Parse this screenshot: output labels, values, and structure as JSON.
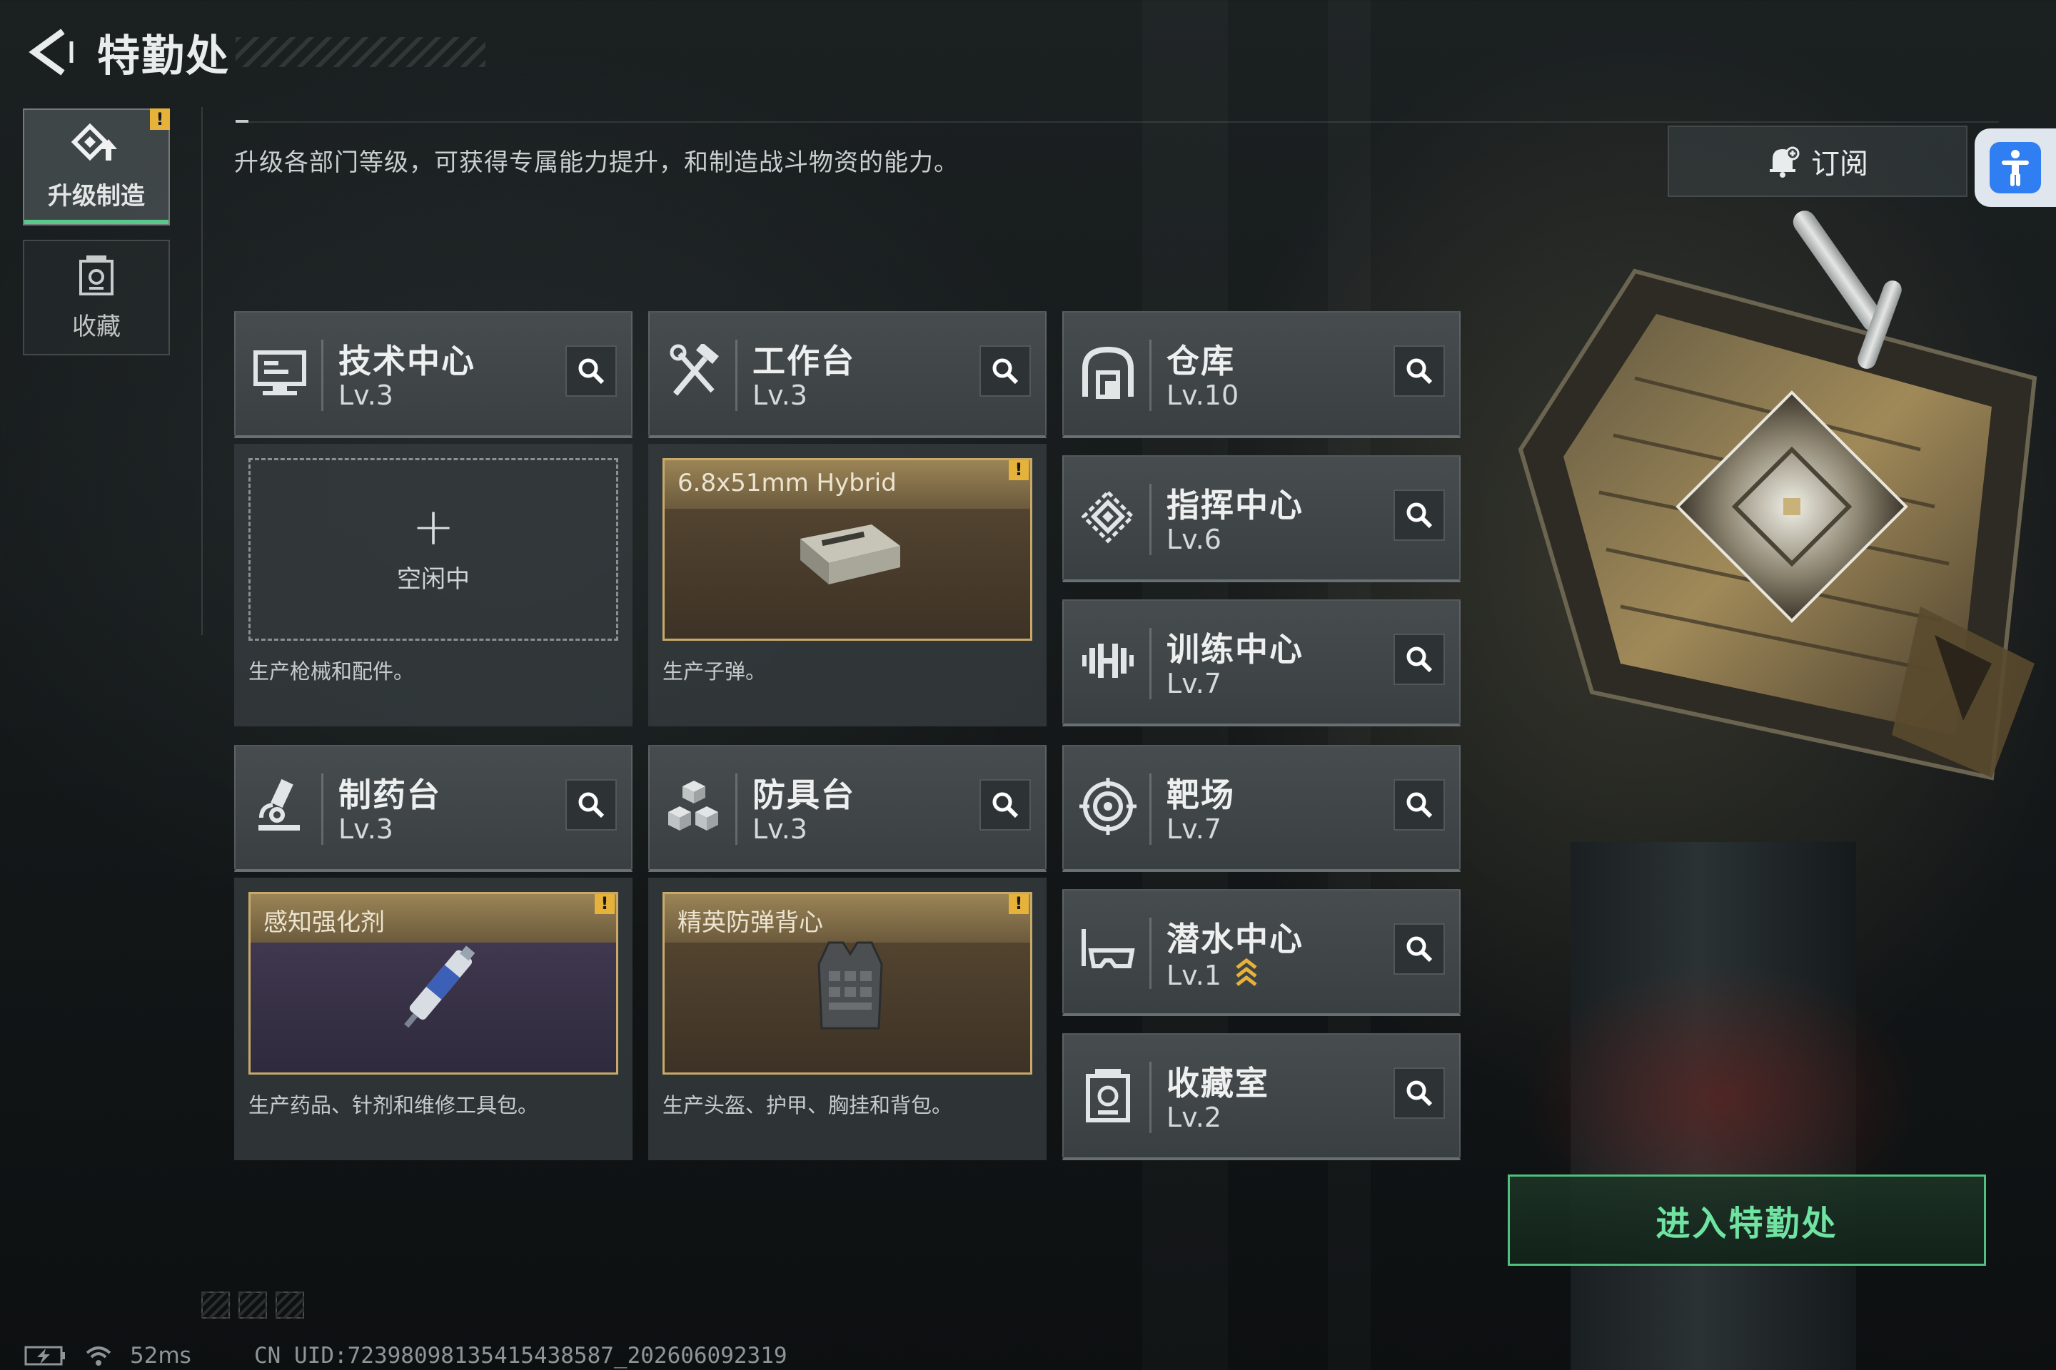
{
  "header": {
    "title": "特勤处",
    "back_icon": "back-arrow-icon"
  },
  "sidebar": {
    "tabs": [
      {
        "label": "升级制造",
        "icon": "upgrade-craft-icon",
        "active": true,
        "alert": "!"
      },
      {
        "label": "收藏",
        "icon": "collection-icon",
        "active": false
      }
    ]
  },
  "description": "升级各部门等级，可获得专属能力提升，和制造战斗物资的能力。",
  "subscribe": {
    "label": "订阅",
    "icon": "bell-plus-icon"
  },
  "accessibility": {
    "icon": "accessibility-person-icon",
    "color": "#2f7ff2"
  },
  "departments": {
    "tech": {
      "name": "技术中心",
      "level": "Lv.3",
      "icon": "monitor-icon"
    },
    "workbench": {
      "name": "工作台",
      "level": "Lv.3",
      "icon": "tools-icon"
    },
    "warehouse": {
      "name": "仓库",
      "level": "Lv.10",
      "icon": "warehouse-icon"
    },
    "command": {
      "name": "指挥中心",
      "level": "Lv.6",
      "icon": "command-icon"
    },
    "training": {
      "name": "训练中心",
      "level": "Lv.7",
      "icon": "dumbbell-icon"
    },
    "pharmacy": {
      "name": "制药台",
      "level": "Lv.3",
      "icon": "microscope-icon"
    },
    "armor": {
      "name": "防具台",
      "level": "Lv.3",
      "icon": "armor-blocks-icon"
    },
    "range": {
      "name": "靶场",
      "level": "Lv.7",
      "icon": "target-icon"
    },
    "diving": {
      "name": "潜水中心",
      "level": "Lv.1",
      "icon": "diving-mask-icon",
      "upgrade_icon": "upgrade-chevrons-icon"
    },
    "collection_room": {
      "name": "收藏室",
      "level": "Lv.2",
      "icon": "collection-icon"
    }
  },
  "panels": {
    "tech": {
      "slot_text": "空闲中",
      "description": "生产枪械和配件。"
    },
    "workbench": {
      "item_name": "6.8x51mm Hybrid",
      "description": "生产子弹。",
      "alert": "!"
    },
    "pharmacy": {
      "item_name": "感知强化剂",
      "description": "生产药品、针剂和维修工具包。",
      "alert": "!"
    },
    "armor": {
      "item_name": "精英防弹背心",
      "description": "生产头盔、护甲、胸挂和背包。",
      "alert": "!"
    }
  },
  "enter_button": {
    "label": "进入特勤处",
    "color": "#4fc07d"
  },
  "status_bar": {
    "ping": "52ms",
    "uid": "CN UID:7239809813541543858​7_202606092319"
  }
}
